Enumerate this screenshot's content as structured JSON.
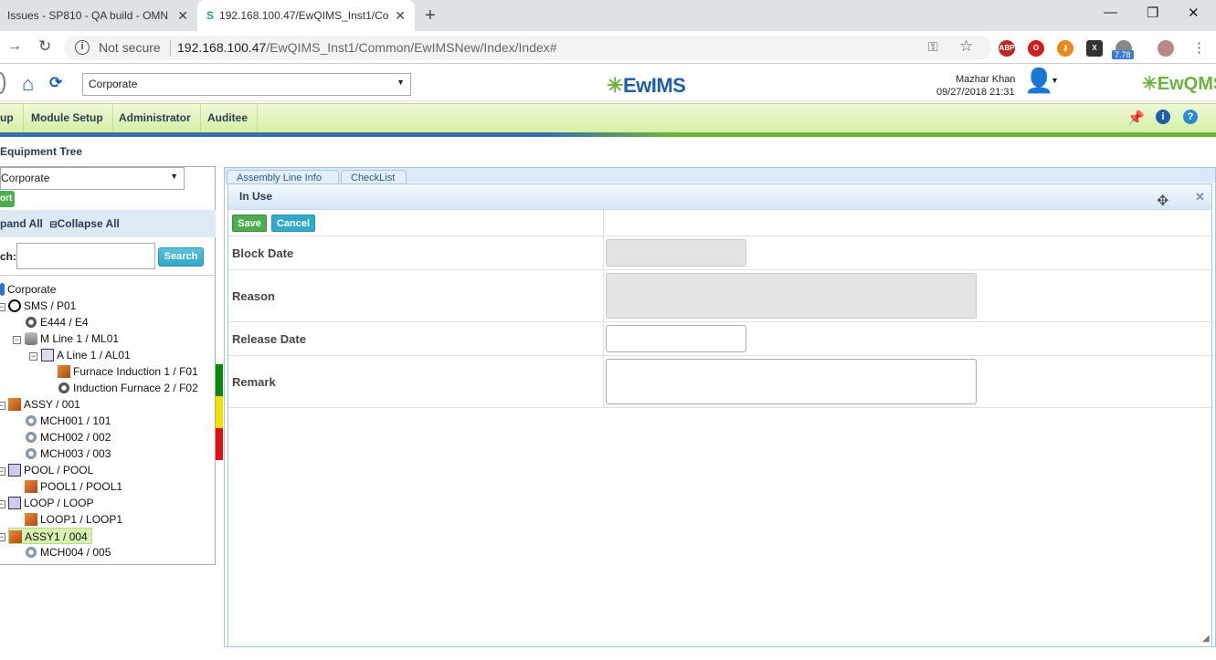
{
  "browser": {
    "tabs": [
      {
        "title": "Issues - SP810 - QA build - OMN"
      },
      {
        "title": "192.168.100.47/EwQIMS_Inst1/Co"
      }
    ],
    "security_label": "Not secure",
    "url_host": "192.168.100.47",
    "url_path": "/EwQIMS_Inst1/Common/EwIMSNew/Index/Index#",
    "extension_badge": "7.78"
  },
  "header": {
    "plant_select": "Corporate",
    "logo": "EwIMS",
    "logo_right": "EwQMS",
    "user_name": "Mazhar Khan",
    "datetime": "09/27/2018 21:31"
  },
  "menu": {
    "items": [
      "up",
      "Module Setup",
      "Administrator",
      "Auditee"
    ]
  },
  "left": {
    "title": "Equipment Tree",
    "select": "Corporate",
    "export_label": "ort",
    "expand_label": "pand All",
    "collapse_label": "Collapse All",
    "search_label": "ch:",
    "search_button": "Search",
    "tree": [
      {
        "label": "Corporate"
      },
      {
        "label": "SMS / P01"
      },
      {
        "label": "E444 / E4"
      },
      {
        "label": "M Line 1 / ML01"
      },
      {
        "label": "A Line 1 / AL01"
      },
      {
        "label": "Furnace Induction 1 / F01"
      },
      {
        "label": "Induction Furnace 2 / F02"
      },
      {
        "label": "ASSY / 001"
      },
      {
        "label": "MCH001 / 101"
      },
      {
        "label": "MCH002 / 002"
      },
      {
        "label": "MCH003 / 003"
      },
      {
        "label": "POOL / POOL"
      },
      {
        "label": "POOL1 / POOL1"
      },
      {
        "label": "LOOP / LOOP"
      },
      {
        "label": "LOOP1 / LOOP1"
      },
      {
        "label": "ASSY1 / 004"
      },
      {
        "label": "MCH004 / 005"
      }
    ]
  },
  "right": {
    "tabs": [
      "Assembly Line Info",
      "CheckList"
    ]
  },
  "dialog": {
    "title": "In Use",
    "save": "Save",
    "cancel": "Cancel",
    "fields": {
      "block_date": "Block Date",
      "reason": "Reason",
      "release_date": "Release Date",
      "remark": "Remark"
    }
  }
}
